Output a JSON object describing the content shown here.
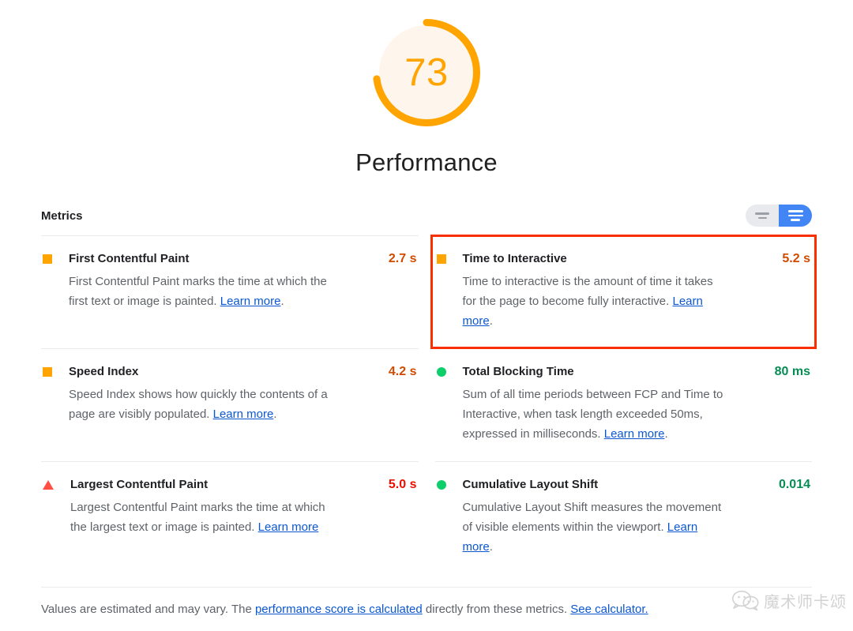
{
  "gauge": {
    "score": "73",
    "title": "Performance",
    "arc_color": "#ffa400",
    "fill_color": "#fef6ec",
    "percent": 73
  },
  "metrics_header": {
    "label": "Metrics",
    "toggle": {
      "collapsed_icon": "list-compact-icon",
      "expanded_icon": "list-expanded-icon",
      "selected": "expanded"
    }
  },
  "metrics": [
    {
      "name": "First Contentful Paint",
      "value": "2.7 s",
      "badge": "square",
      "badge_color": "#ffa400",
      "value_class": "v-orange",
      "desc_before": "First Contentful Paint marks the time at which the first text or image is painted. ",
      "link": "Learn more",
      "desc_after": ".",
      "highlighted": false
    },
    {
      "name": "Time to Interactive",
      "value": "5.2 s",
      "badge": "square",
      "badge_color": "#ffa400",
      "value_class": "v-orange",
      "desc_before": "Time to interactive is the amount of time it takes for the page to become fully interactive. ",
      "link": "Learn more",
      "desc_after": ".",
      "highlighted": true
    },
    {
      "name": "Speed Index",
      "value": "4.2 s",
      "badge": "square",
      "badge_color": "#ffa400",
      "value_class": "v-orange",
      "desc_before": "Speed Index shows how quickly the contents of a page are visibly populated. ",
      "link": "Learn more",
      "desc_after": ".",
      "highlighted": false
    },
    {
      "name": "Total Blocking Time",
      "value": "80 ms",
      "badge": "circle",
      "badge_color": "#0cce6b",
      "value_class": "v-green",
      "desc_before": "Sum of all time periods between FCP and Time to Interactive, when task length exceeded 50ms, expressed in milliseconds. ",
      "link": "Learn more",
      "desc_after": ".",
      "highlighted": false
    },
    {
      "name": "Largest Contentful Paint",
      "value": "5.0 s",
      "badge": "triangle",
      "badge_color": "#ff4e42",
      "value_class": "v-red",
      "desc_before": "Largest Contentful Paint marks the time at which the largest text or image is painted. ",
      "link": "Learn more",
      "desc_after": "",
      "highlighted": false
    },
    {
      "name": "Cumulative Layout Shift",
      "value": "0.014",
      "badge": "circle",
      "badge_color": "#0cce6b",
      "value_class": "v-green",
      "desc_before": "Cumulative Layout Shift measures the movement of visible elements within the viewport. ",
      "link": "Learn more",
      "desc_after": ".",
      "highlighted": false
    }
  ],
  "footer": {
    "part1": "Values are estimated and may vary. The ",
    "link1": "performance score is calculated",
    "part2": " directly from these metrics. ",
    "link2": "See calculator."
  },
  "watermark": {
    "icon": "wechat-icon",
    "text": "魔术师卡颂"
  }
}
